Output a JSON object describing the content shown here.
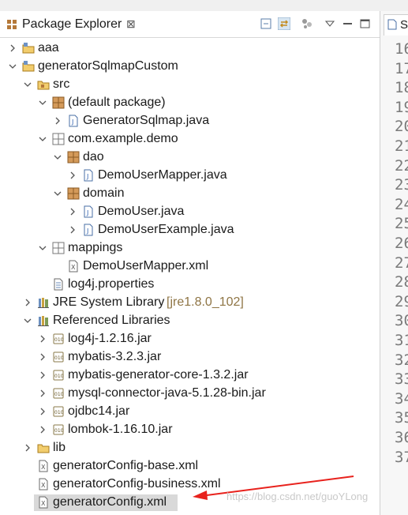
{
  "explorer": {
    "title": "Package Explorer",
    "close_glyph": "⊠",
    "toolbar": [
      "collapse-all-icon",
      "link-with-editor-icon",
      "view-menu-icon",
      "view-menu-chevron-icon",
      "minimize-icon",
      "maximize-icon"
    ]
  },
  "tree": [
    {
      "label": "aaa",
      "icon": "project-icon",
      "depth": 0,
      "twisty": "collapsed"
    },
    {
      "label": "generatorSqlmapCustom",
      "icon": "project-icon",
      "depth": 0,
      "twisty": "expanded"
    },
    {
      "label": "src",
      "icon": "source-folder-icon",
      "depth": 1,
      "twisty": "expanded"
    },
    {
      "label": "(default package)",
      "icon": "package-icon",
      "depth": 2,
      "twisty": "expanded"
    },
    {
      "label": "GeneratorSqlmap.java",
      "icon": "java-file-icon",
      "depth": 3,
      "twisty": "collapsed"
    },
    {
      "label": "com.example.demo",
      "icon": "package-empty-icon",
      "depth": 2,
      "twisty": "expanded"
    },
    {
      "label": "dao",
      "icon": "package-icon",
      "depth": 3,
      "twisty": "expanded"
    },
    {
      "label": "DemoUserMapper.java",
      "icon": "java-file-icon",
      "depth": 4,
      "twisty": "collapsed"
    },
    {
      "label": "domain",
      "icon": "package-icon",
      "depth": 3,
      "twisty": "expanded"
    },
    {
      "label": "DemoUser.java",
      "icon": "java-file-icon",
      "depth": 4,
      "twisty": "collapsed"
    },
    {
      "label": "DemoUserExample.java",
      "icon": "java-file-icon",
      "depth": 4,
      "twisty": "collapsed"
    },
    {
      "label": "mappings",
      "icon": "package-empty-icon",
      "depth": 2,
      "twisty": "expanded"
    },
    {
      "label": "DemoUserMapper.xml",
      "icon": "xml-file-icon",
      "depth": 3,
      "twisty": "none"
    },
    {
      "label": "log4j.properties",
      "icon": "properties-file-icon",
      "depth": 2,
      "twisty": "none"
    },
    {
      "label": "JRE System Library",
      "decoration": "[jre1.8.0_102]",
      "icon": "library-icon",
      "depth": 1,
      "twisty": "collapsed"
    },
    {
      "label": "Referenced Libraries",
      "icon": "library-icon",
      "depth": 1,
      "twisty": "expanded"
    },
    {
      "label": "log4j-1.2.16.jar",
      "icon": "jar-icon",
      "depth": 2,
      "twisty": "collapsed"
    },
    {
      "label": "mybatis-3.2.3.jar",
      "icon": "jar-icon",
      "depth": 2,
      "twisty": "collapsed"
    },
    {
      "label": "mybatis-generator-core-1.3.2.jar",
      "icon": "jar-icon",
      "depth": 2,
      "twisty": "collapsed"
    },
    {
      "label": "mysql-connector-java-5.1.28-bin.jar",
      "icon": "jar-icon",
      "depth": 2,
      "twisty": "collapsed"
    },
    {
      "label": "ojdbc14.jar",
      "icon": "jar-icon",
      "depth": 2,
      "twisty": "collapsed"
    },
    {
      "label": "lombok-1.16.10.jar",
      "icon": "jar-icon",
      "depth": 2,
      "twisty": "collapsed"
    },
    {
      "label": "lib",
      "icon": "folder-icon",
      "depth": 1,
      "twisty": "collapsed"
    },
    {
      "label": "generatorConfig-base.xml",
      "icon": "xml-file-icon",
      "depth": 1,
      "twisty": "none"
    },
    {
      "label": "generatorConfig-business.xml",
      "icon": "xml-file-icon",
      "depth": 1,
      "twisty": "none"
    },
    {
      "label": "generatorConfig.xml",
      "icon": "xml-file-icon",
      "depth": 1,
      "twisty": "none",
      "selected": true
    }
  ],
  "editor": {
    "tab_label": "S",
    "line_numbers": [
      "16",
      "17",
      "18",
      "19",
      "20",
      "21",
      "22",
      "23",
      "24",
      "25",
      "26",
      "27",
      "28",
      "29",
      "30",
      "31",
      "32",
      "33",
      "34",
      "35",
      "36",
      "37"
    ]
  },
  "annotation": {
    "color": "#e8221d"
  },
  "watermark": "https://blog.csdn.net/guoYLong",
  "colors": {
    "selection": "#d9d9d9",
    "decoration": "#8f7545",
    "package": "#b5793a",
    "java": "#2d5fb0"
  }
}
